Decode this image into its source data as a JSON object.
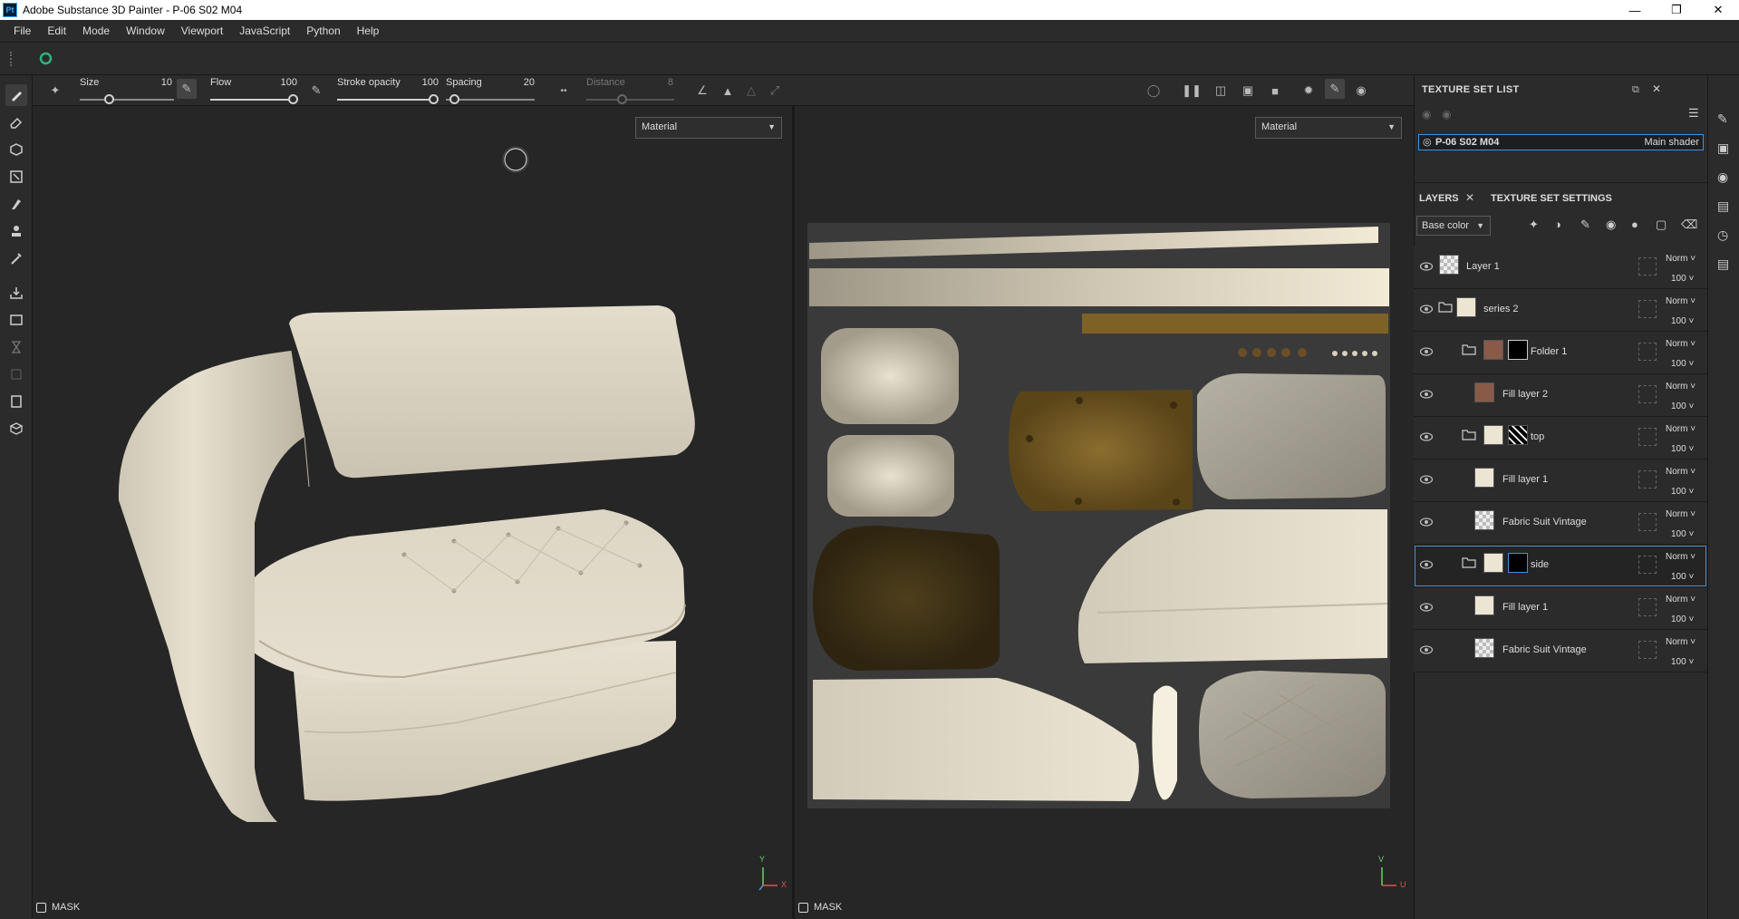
{
  "window": {
    "title": "Adobe Substance 3D Painter - P-06 S02 M04",
    "app_icon": "Pt"
  },
  "menu": [
    "File",
    "Edit",
    "Mode",
    "Window",
    "Viewport",
    "JavaScript",
    "Python",
    "Help"
  ],
  "toolbar": {
    "size": {
      "label": "Size",
      "value": "10"
    },
    "flow": {
      "label": "Flow",
      "value": "100"
    },
    "stroke_opacity": {
      "label": "Stroke opacity",
      "value": "100"
    },
    "spacing": {
      "label": "Spacing",
      "value": "20"
    },
    "distance": {
      "label": "Distance",
      "value": "8"
    }
  },
  "viewport3d": {
    "mode": "Material",
    "mask_label": "MASK",
    "axes": {
      "y": "Y",
      "x": "X"
    }
  },
  "viewport2d": {
    "mode": "Material",
    "mask_label": "MASK",
    "axes": {
      "v": "V",
      "u": "U"
    }
  },
  "texture_set_list": {
    "title": "TEXTURE SET LIST",
    "item": {
      "name": "P-06 S02 M04",
      "shader": "Main shader"
    }
  },
  "tabs": {
    "layers": "LAYERS",
    "settings": "TEXTURE SET SETTINGS"
  },
  "channel": "Base color",
  "layers": [
    {
      "name": "Layer 1",
      "blend": "Norm",
      "opacity": "100"
    },
    {
      "name": "series 2",
      "blend": "Norm",
      "opacity": "100"
    },
    {
      "name": "Folder 1",
      "blend": "Norm",
      "opacity": "100"
    },
    {
      "name": "Fill layer 2",
      "blend": "Norm",
      "opacity": "100"
    },
    {
      "name": "top",
      "blend": "Norm",
      "opacity": "100"
    },
    {
      "name": "Fill layer 1",
      "blend": "Norm",
      "opacity": "100"
    },
    {
      "name": "Fabric Suit Vintage",
      "blend": "Norm",
      "opacity": "100"
    },
    {
      "name": "side",
      "blend": "Norm",
      "opacity": "100"
    },
    {
      "name": "Fill layer 1",
      "blend": "Norm",
      "opacity": "100"
    },
    {
      "name": "Fabric Suit Vintage",
      "blend": "Norm",
      "opacity": "100"
    }
  ]
}
